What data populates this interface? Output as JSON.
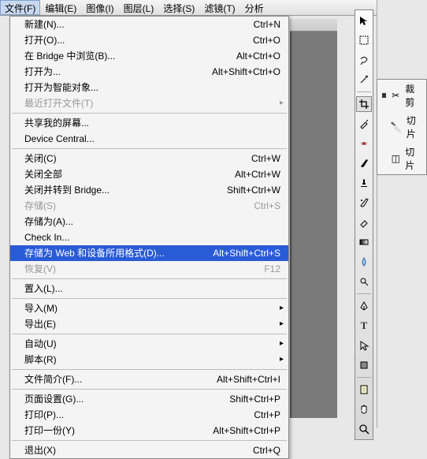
{
  "menubar": {
    "file": "文件(F)",
    "edit": "编辑(E)",
    "image": "图像(I)",
    "layer": "图层(L)",
    "select": "选择(S)",
    "filter": "滤镜(T)",
    "analyze": "分析"
  },
  "menu": {
    "new": {
      "label": "新建(N)...",
      "short": "Ctrl+N"
    },
    "open": {
      "label": "打开(O)...",
      "short": "Ctrl+O"
    },
    "bridge": {
      "label": "在 Bridge 中浏览(B)...",
      "short": "Alt+Ctrl+O"
    },
    "openas": {
      "label": "打开为...",
      "short": "Alt+Shift+Ctrl+O"
    },
    "opensmart": {
      "label": "打开为智能对象...",
      "short": ""
    },
    "recent": {
      "label": "最近打开文件(T)",
      "short": ""
    },
    "share": {
      "label": "共享我的屏幕...",
      "short": ""
    },
    "devcentral": {
      "label": "Device Central...",
      "short": ""
    },
    "close": {
      "label": "关闭(C)",
      "short": "Ctrl+W"
    },
    "closeall": {
      "label": "关闭全部",
      "short": "Alt+Ctrl+W"
    },
    "closego": {
      "label": "关闭并转到 Bridge...",
      "short": "Shift+Ctrl+W"
    },
    "save": {
      "label": "存储(S)",
      "short": "Ctrl+S"
    },
    "saveas": {
      "label": "存储为(A)...",
      "short": ""
    },
    "checkin": {
      "label": "Check In...",
      "short": ""
    },
    "saveweb": {
      "label": "存储为 Web 和设备所用格式(D)...",
      "short": "Alt+Shift+Ctrl+S"
    },
    "revert": {
      "label": "恢复(V)",
      "short": "F12"
    },
    "place": {
      "label": "置入(L)...",
      "short": ""
    },
    "import": {
      "label": "导入(M)",
      "short": ""
    },
    "export": {
      "label": "导出(E)",
      "short": ""
    },
    "auto": {
      "label": "自动(U)",
      "short": ""
    },
    "scripts": {
      "label": "脚本(R)",
      "short": ""
    },
    "info": {
      "label": "文件简介(F)...",
      "short": "Alt+Shift+Ctrl+I"
    },
    "pagesetup": {
      "label": "页面设置(G)...",
      "short": "Shift+Ctrl+P"
    },
    "print": {
      "label": "打印(P)...",
      "short": "Ctrl+P"
    },
    "printone": {
      "label": "打印一份(Y)",
      "short": "Alt+Shift+Ctrl+P"
    },
    "exit": {
      "label": "退出(X)",
      "short": "Ctrl+Q"
    }
  },
  "flyout": {
    "crop": "裁剪",
    "slice": "切片",
    "slicesel": "切片"
  }
}
